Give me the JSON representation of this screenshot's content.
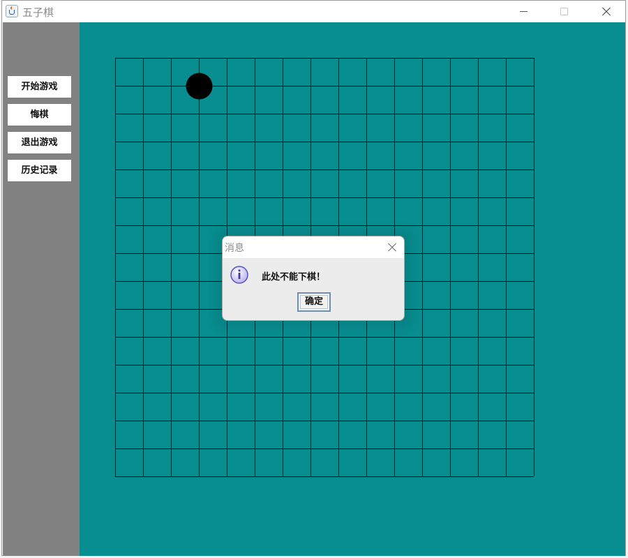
{
  "window": {
    "title": "五子棋"
  },
  "sidebar": {
    "buttons": [
      "开始游戏",
      "悔棋",
      "退出游戏",
      "历史记录"
    ]
  },
  "board": {
    "rows": 15,
    "cols": 15,
    "background_color": "#088e90",
    "line_color": "#000000",
    "stones": [
      {
        "color": "black",
        "col": 3,
        "row": 1
      }
    ]
  },
  "dialog": {
    "title": "消息",
    "message": "此处不能下棋！",
    "ok_label": "确定",
    "icon": "info-icon"
  },
  "colors": {
    "sidebar": "#828282",
    "board": "#088e90",
    "dialog_bg": "#ececec"
  }
}
